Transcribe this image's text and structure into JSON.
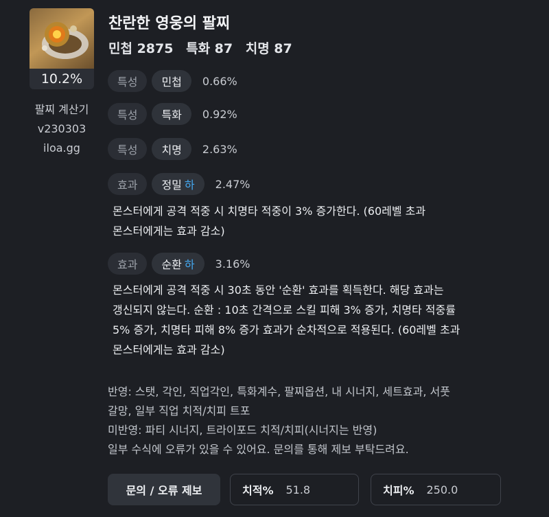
{
  "item": {
    "name": "찬란한 영웅의 팔찌",
    "percent": "10.2%",
    "stats": [
      "민첩 2875",
      "특화 87",
      "치명 87"
    ]
  },
  "calculator": {
    "title": "팔찌 계산기",
    "version": "v230303",
    "site": "iloa.gg"
  },
  "options": [
    {
      "tag": "특성",
      "name": "민첩",
      "grade": "",
      "value": "0.66%"
    },
    {
      "tag": "특성",
      "name": "특화",
      "grade": "",
      "value": "0.92%"
    },
    {
      "tag": "특성",
      "name": "치명",
      "grade": "",
      "value": "2.63%"
    },
    {
      "tag": "효과",
      "name": "정밀",
      "grade": "하",
      "value": "2.47%",
      "desc": [
        "몬스터에게 공격 적중 시 치명타 적중이 3% 증가한다. (60레벨 초과",
        "몬스터에게는 효과 감소)"
      ]
    },
    {
      "tag": "효과",
      "name": "순환",
      "grade": "하",
      "value": "3.16%",
      "desc": [
        "몬스터에게 공격 적중 시 30초 동안 '순환' 효과를 획득한다. 해당 효과는",
        "갱신되지 않는다. 순환 : 10초 간격으로 스킬 피해 3% 증가, 치명타 적중률",
        "5% 증가, 치명타 피해 8% 증가 효과가 순차적으로 적용된다. (60레벨 초과",
        "몬스터에게는 효과 감소)"
      ]
    }
  ],
  "notes": [
    "반영: 스탯, 각인, 직업각인, 특화계수, 팔찌옵션, 내 시너지, 세트효과, 서풋",
    "갈망, 일부 직업 치적/치피 트포",
    "미반영: 파티 시너지, 트라이포드 치적/치피(시너지는 반영)",
    "일부 수식에 오류가 있을 수 있어요. 문의를 통해 제보 부탁드려요."
  ],
  "footer": {
    "report_button": "문의 / 오류 제보",
    "crit_rate_label": "치적%",
    "crit_rate_value": "51.8",
    "crit_dmg_label": "치피%",
    "crit_dmg_value": "250.0"
  },
  "colors": {
    "grade": "#44a8f0",
    "background": "#1d1f24"
  },
  "icons": {
    "item": "bracelet-icon"
  }
}
